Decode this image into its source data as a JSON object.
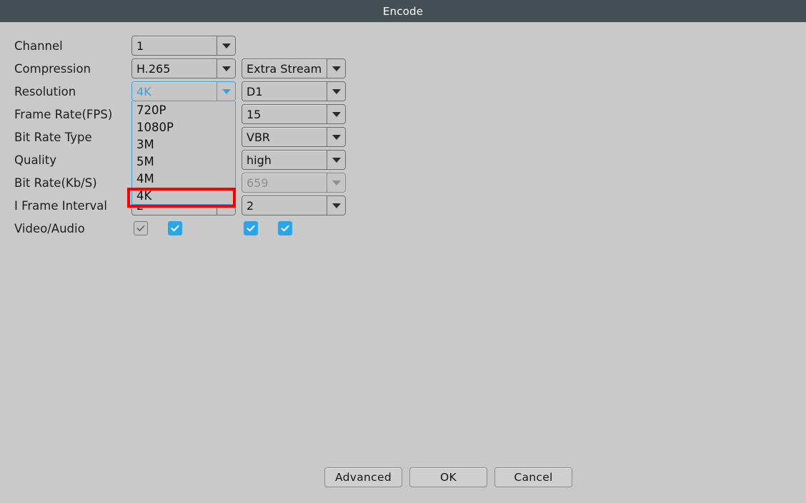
{
  "window": {
    "title": "Encode"
  },
  "colors": {
    "titlebar_bg": "#434f54",
    "dialog_bg": "#c9c9c9",
    "accent_blue": "#3b9fe0",
    "checkbox_blue": "#29a5ee",
    "annotation_red": "#ff0000"
  },
  "form": {
    "labels": {
      "channel": "Channel",
      "compression": "Compression",
      "resolution": "Resolution",
      "frame_rate": "Frame Rate(FPS)",
      "bit_rate_type": "Bit Rate Type",
      "quality": "Quality",
      "bit_rate": "Bit Rate(Kb/S)",
      "i_frame_interval": "I Frame Interval",
      "video_audio": "Video/Audio"
    },
    "main_stream": {
      "channel": "1",
      "compression": "H.265",
      "resolution": "4K",
      "i_frame_interval": "2"
    },
    "extra_stream": {
      "stream_type": "Extra Stream",
      "resolution": "D1",
      "frame_rate": "15",
      "bit_rate_type": "VBR",
      "quality": "high",
      "bit_rate": "659",
      "i_frame_interval": "2"
    }
  },
  "resolution_dropdown": {
    "open": true,
    "selected": "4K",
    "options": [
      "720P",
      "1080P",
      "3M",
      "5M",
      "4M",
      "4K"
    ]
  },
  "checkboxes": [
    {
      "name": "main-video",
      "checked": true,
      "enabled": false
    },
    {
      "name": "main-audio",
      "checked": true,
      "enabled": true
    },
    {
      "name": "extra-video",
      "checked": true,
      "enabled": true
    },
    {
      "name": "extra-audio",
      "checked": true,
      "enabled": true
    }
  ],
  "buttons": {
    "advanced": "Advanced",
    "ok": "OK",
    "cancel": "Cancel"
  }
}
